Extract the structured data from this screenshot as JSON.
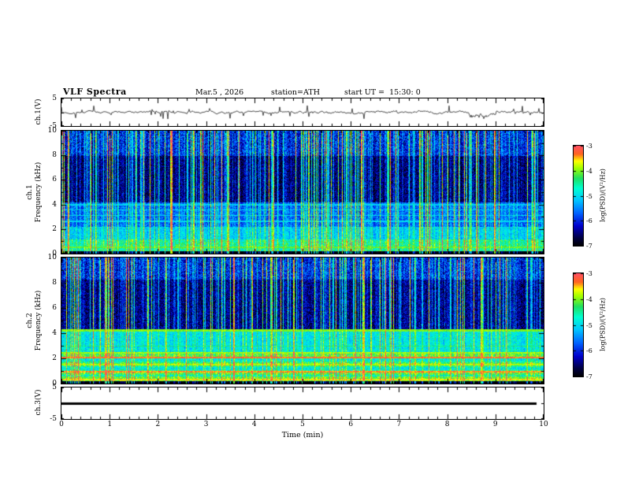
{
  "header": {
    "title": "VLF Spectra",
    "date": "Mar.5 , 2026",
    "station": "station=ATH",
    "start_ut": "start UT =  15:30: 0"
  },
  "xaxis": {
    "label": "Time (min)",
    "ticks": [
      0,
      1,
      2,
      3,
      4,
      5,
      6,
      7,
      8,
      9,
      10
    ],
    "lim": [
      0,
      10
    ]
  },
  "panels": {
    "ch1v": {
      "ylabel": "ch.1(V)",
      "yticks": [
        5,
        -5
      ],
      "ylim": [
        -5,
        5
      ]
    },
    "spec1": {
      "ylabel_ch": "ch.1",
      "ylabel_freq": "Frequency (kHz)",
      "yticks": [
        10,
        8,
        6,
        4,
        2,
        0
      ],
      "ylim": [
        0,
        10
      ]
    },
    "spec2": {
      "ylabel_ch": "ch.2",
      "ylabel_freq": "Frequency (kHz)",
      "yticks": [
        10,
        8,
        6,
        4,
        2,
        0
      ],
      "ylim": [
        0,
        10
      ]
    },
    "ch3v": {
      "ylabel": "ch.3(V)",
      "yticks": [
        5,
        -5
      ],
      "ylim": [
        -5,
        5
      ]
    }
  },
  "colorbar": {
    "label": "log(PSD)/(V²/Hz)",
    "ticks": [
      -3,
      -4,
      -5,
      -6,
      -7
    ],
    "lim": [
      -7,
      -3
    ]
  },
  "chart_data": [
    {
      "type": "line",
      "panel": "ch.1(V)",
      "xlabel": "Time (min)",
      "xlim": [
        0,
        10
      ],
      "ylabel": "ch.1(V)",
      "ylim": [
        -5,
        5
      ],
      "yticks": [
        5,
        -5
      ],
      "series": [
        {
          "name": "ch.1 voltage",
          "summary": "Noisy broadband waveform centered near 0 V with dense impulsive sferic spikes up to about ±4 V; slight negative excursion near 8.5–9 min."
        }
      ]
    },
    {
      "type": "heatmap",
      "panel": "ch.1 spectrogram",
      "xlabel": "Time (min)",
      "xlim": [
        0,
        10
      ],
      "ylabel": "ch.1 Frequency (kHz)",
      "ylim": [
        0,
        10
      ],
      "yticks": [
        0,
        2,
        4,
        6,
        8,
        10
      ],
      "zlabel": "log(PSD)/(V²/Hz)",
      "zlim": [
        -7,
        -3
      ],
      "summary": "Black band 0–0.3 kHz; strong green power 0.3–1.2 kHz; cyan 1.2–2.2 kHz; blue 2.2–4.2 kHz with faint horizontal lines near 2.6, 3.1, 3.6 and 4.0 kHz; dark 4–10 kHz crossed by dense full-height vertical sferic streaks (green/yellow)."
    },
    {
      "type": "heatmap",
      "panel": "ch.2 spectrogram",
      "xlabel": "Time (min)",
      "xlim": [
        0,
        10
      ],
      "ylabel": "ch.2 Frequency (kHz)",
      "ylim": [
        0,
        10
      ],
      "yticks": [
        0,
        2,
        4,
        6,
        8,
        10
      ],
      "zlabel": "log(PSD)/(V²/Hz)",
      "zlim": [
        -7,
        -3
      ],
      "summary": "Black band near 0 kHz; bright green with yellow/orange horizontal banding below ~2.7 kHz (lines near 0.35, 0.95, 1.55, 2.1, 2.45 kHz); green-cyan 2.7–4.3 kHz with a yellow-green line near 4.25 kHz; dark 4.3–10 kHz with dense vertical sferic streaks."
    },
    {
      "type": "line",
      "panel": "ch.3(V)",
      "xlabel": "Time (min)",
      "xlim": [
        0,
        10
      ],
      "ylabel": "ch.3(V)",
      "ylim": [
        -5,
        5
      ],
      "yticks": [
        5,
        -5
      ],
      "series": [
        {
          "name": "ch.3 voltage",
          "summary": "Constant flat thick black trace at 0 V across the whole interval (channel inactive)."
        }
      ]
    }
  ],
  "render": {
    "colormap_stops": [
      [
        0.0,
        "#000000"
      ],
      [
        0.08,
        "#000040"
      ],
      [
        0.2,
        "#0000cc"
      ],
      [
        0.33,
        "#0064ff"
      ],
      [
        0.46,
        "#00c8ff"
      ],
      [
        0.58,
        "#00ffd0"
      ],
      [
        0.68,
        "#20e060"
      ],
      [
        0.78,
        "#a0ff00"
      ],
      [
        0.85,
        "#ffff00"
      ],
      [
        0.92,
        "#ff6420"
      ],
      [
        1.0,
        "#ff5064"
      ]
    ],
    "wave1": {
      "seed": 7,
      "base_amp": 0.55,
      "spike_prob": 0.1,
      "spike_amp": 3.2,
      "dip": {
        "x0": 0.845,
        "x1": 0.9,
        "off": -1.3
      }
    },
    "ch3": {
      "value": 0,
      "thickness": 3,
      "x0": 0.0,
      "x1": 0.985
    },
    "spec1": {
      "seed": 11,
      "streak_prob": 0.55,
      "streak_max": 3.2,
      "bands": [
        {
          "f0": 0,
          "f1": 0.25,
          "base": -7.0,
          "noise": 0.1,
          "streak_w": 1.1
        },
        {
          "f0": 0.25,
          "f1": 1.2,
          "base": -4.6,
          "noise": 0.5,
          "streak_w": 0.5
        },
        {
          "f0": 1.2,
          "f1": 2.2,
          "base": -5.15,
          "noise": 0.4,
          "streak_w": 0.6
        },
        {
          "f0": 2.2,
          "f1": 4.2,
          "base": -5.7,
          "noise": 0.45,
          "streak_w": 0.8
        },
        {
          "f0": 4.2,
          "f1": 8.0,
          "base": -6.55,
          "noise": 0.5,
          "streak_w": 1.0
        },
        {
          "f0": 8.0,
          "f1": 10.0,
          "base": -6.05,
          "noise": 0.6,
          "streak_w": 1.0
        }
      ],
      "hlines": [
        {
          "f": 0.55,
          "v": -4.1,
          "w": 0.06
        },
        {
          "f": 2.65,
          "v": -5.05,
          "w": 0.05
        },
        {
          "f": 3.15,
          "v": -5.0,
          "w": 0.05
        },
        {
          "f": 3.6,
          "v": -5.05,
          "w": 0.05
        },
        {
          "f": 4.0,
          "v": -5.1,
          "w": 0.05
        }
      ]
    },
    "spec2": {
      "seed": 23,
      "streak_prob": 0.5,
      "streak_max": 3.0,
      "ripple": {
        "f0": 0.6,
        "f1": 2.7,
        "k": 9.0,
        "a": 0.38
      },
      "bands": [
        {
          "f0": 0,
          "f1": 0.2,
          "base": -7.0,
          "noise": 0.1,
          "streak_w": 1.0
        },
        {
          "f0": 0.2,
          "f1": 0.6,
          "base": -4.15,
          "noise": 0.4,
          "streak_w": 0.4
        },
        {
          "f0": 0.6,
          "f1": 2.7,
          "base": -4.55,
          "noise": 0.45,
          "streak_w": 0.45
        },
        {
          "f0": 2.7,
          "f1": 4.3,
          "base": -4.95,
          "noise": 0.4,
          "streak_w": 0.5
        },
        {
          "f0": 4.3,
          "f1": 8.3,
          "base": -6.45,
          "noise": 0.5,
          "streak_w": 1.0
        },
        {
          "f0": 8.3,
          "f1": 10.0,
          "base": -6.0,
          "noise": 0.6,
          "streak_w": 1.0
        }
      ],
      "hlines": [
        {
          "f": 0.35,
          "v": -3.6,
          "w": 0.08
        },
        {
          "f": 0.95,
          "v": -3.4,
          "w": 0.07
        },
        {
          "f": 1.55,
          "v": -3.9,
          "w": 0.06
        },
        {
          "f": 2.1,
          "v": -3.3,
          "w": 0.07
        },
        {
          "f": 2.45,
          "v": -3.9,
          "w": 0.05
        },
        {
          "f": 3.0,
          "v": -4.4,
          "w": 0.05
        },
        {
          "f": 4.25,
          "v": -4.0,
          "w": 0.07
        }
      ]
    }
  }
}
